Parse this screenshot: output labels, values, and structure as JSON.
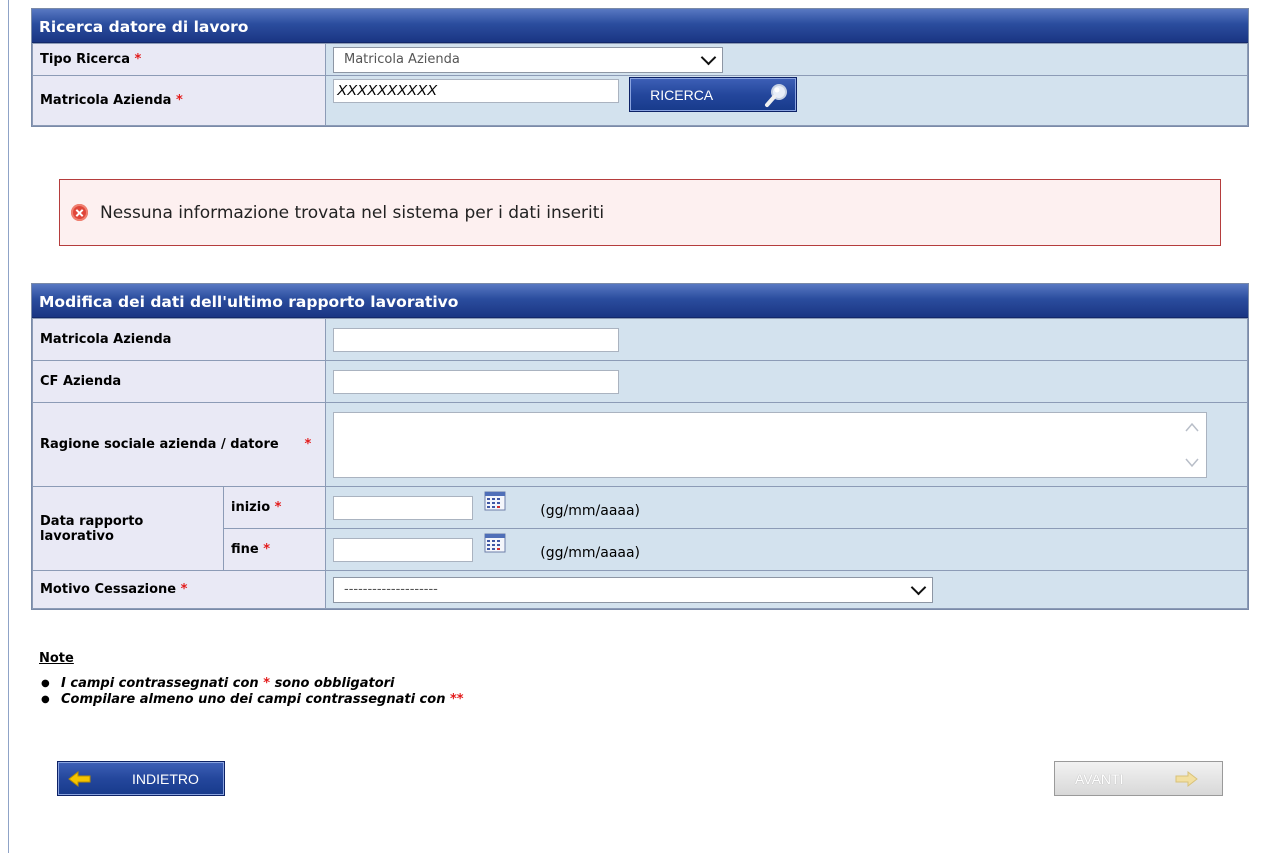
{
  "search_panel": {
    "title": "Ricerca datore di lavoro",
    "tipo_label": "Tipo Ricerca",
    "tipo_value": "Matricola Azienda",
    "matricola_label": "Matricola Azienda",
    "matricola_value": "XXXXXXXXXX",
    "search_button": "RICERCA"
  },
  "required_mark": "*",
  "error_message": "Nessuna informazione trovata nel sistema per i dati inseriti",
  "edit_panel": {
    "title": "Modifica dei dati dell'ultimo rapporto lavorativo",
    "matricola_label": "Matricola Azienda",
    "cf_label": "CF Azienda",
    "ragione_label": "Ragione sociale azienda / datore",
    "data_label": "Data rapporto lavorativo",
    "inizio_label": "inizio",
    "fine_label": "fine",
    "date_format": "(gg/mm/aaaa)",
    "motivo_label": "Motivo Cessazione",
    "motivo_value": "--------------------"
  },
  "notes": {
    "title": "Note",
    "item1": "I campi contrassegnati con",
    "item1_end": "sono obbligatori",
    "item2": "Compilare almeno uno dei campi contrassegnati con",
    "double_mark": "**"
  },
  "buttons": {
    "back": "INDIETRO",
    "next": "AVANTI"
  }
}
